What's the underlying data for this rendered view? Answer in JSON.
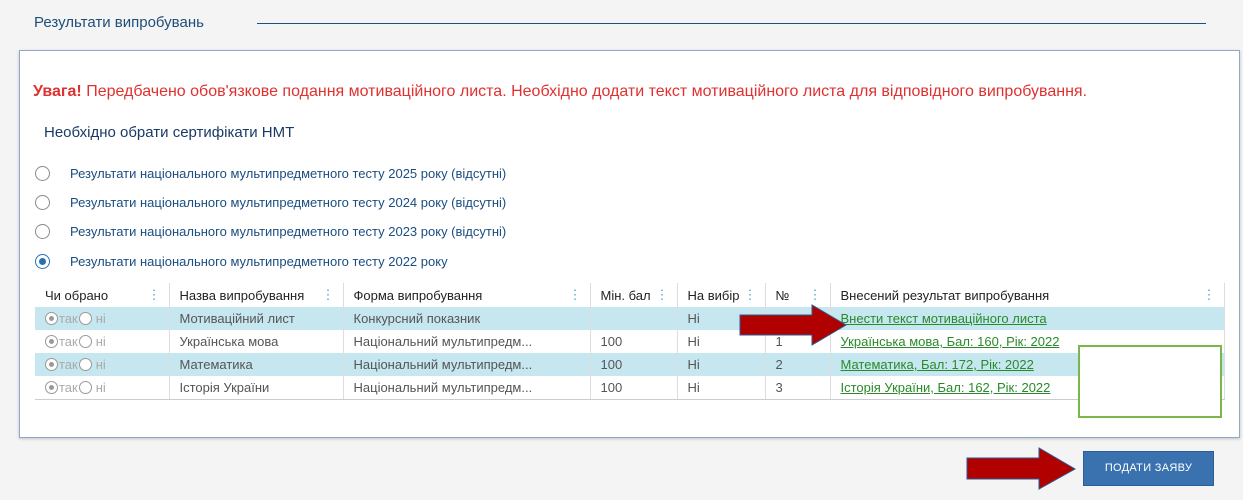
{
  "section": {
    "title": "Результати випробувань"
  },
  "warning": {
    "bold": "Увага!",
    "text": " Передбачено обов'язкове подання мотиваційного листа. Необхідно додати текст мотиваційного листа для відповідного випробування."
  },
  "certificates": {
    "label": "Необхідно обрати сертифікати НМТ",
    "options": [
      {
        "label": "Результати національного мультипредметного тесту 2025 року (відсутні)",
        "selected": false
      },
      {
        "label": "Результати національного мультипредметного тесту 2024 року (відсутні)",
        "selected": false
      },
      {
        "label": "Результати національного мультипредметного тесту 2023 року (відсутні)",
        "selected": false
      },
      {
        "label": "Результати національного мультипредметного тесту 2022 року",
        "selected": true
      }
    ]
  },
  "table": {
    "headers": [
      "Чи обрано",
      "Назва випробування",
      "Форма випробування",
      "Мін. бал",
      "На вибір",
      "№",
      "Внесений результат випробування"
    ],
    "yes_label": "так",
    "no_label": "ні",
    "rows": [
      {
        "name": "Мотиваційний лист",
        "form": "Конкурсний показник",
        "min": "",
        "choice": "Ні",
        "num": "",
        "result": "Внести текст мотиваційного листа"
      },
      {
        "name": "Українська мова",
        "form": "Національний мультипредм...",
        "min": "100",
        "choice": "Ні",
        "num": "1",
        "result": "Українська мова, Бал: 160, Рік: 2022"
      },
      {
        "name": "Математика",
        "form": "Національний мультипредм...",
        "min": "100",
        "choice": "Ні",
        "num": "2",
        "result": "Математика, Бал: 172, Рік: 2022"
      },
      {
        "name": "Історія України",
        "form": "Національний мультипредм...",
        "min": "100",
        "choice": "Ні",
        "num": "3",
        "result": "Історія України, Бал: 162, Рік: 2022"
      }
    ]
  },
  "submit": {
    "label": "ПОДАТИ ЗАЯВУ"
  },
  "colors": {
    "accent": "#3a72b0",
    "warning": "#e03030",
    "row_highlight": "#c6e7ef",
    "link": "#2a8a2a",
    "arrow": "#b00000"
  }
}
